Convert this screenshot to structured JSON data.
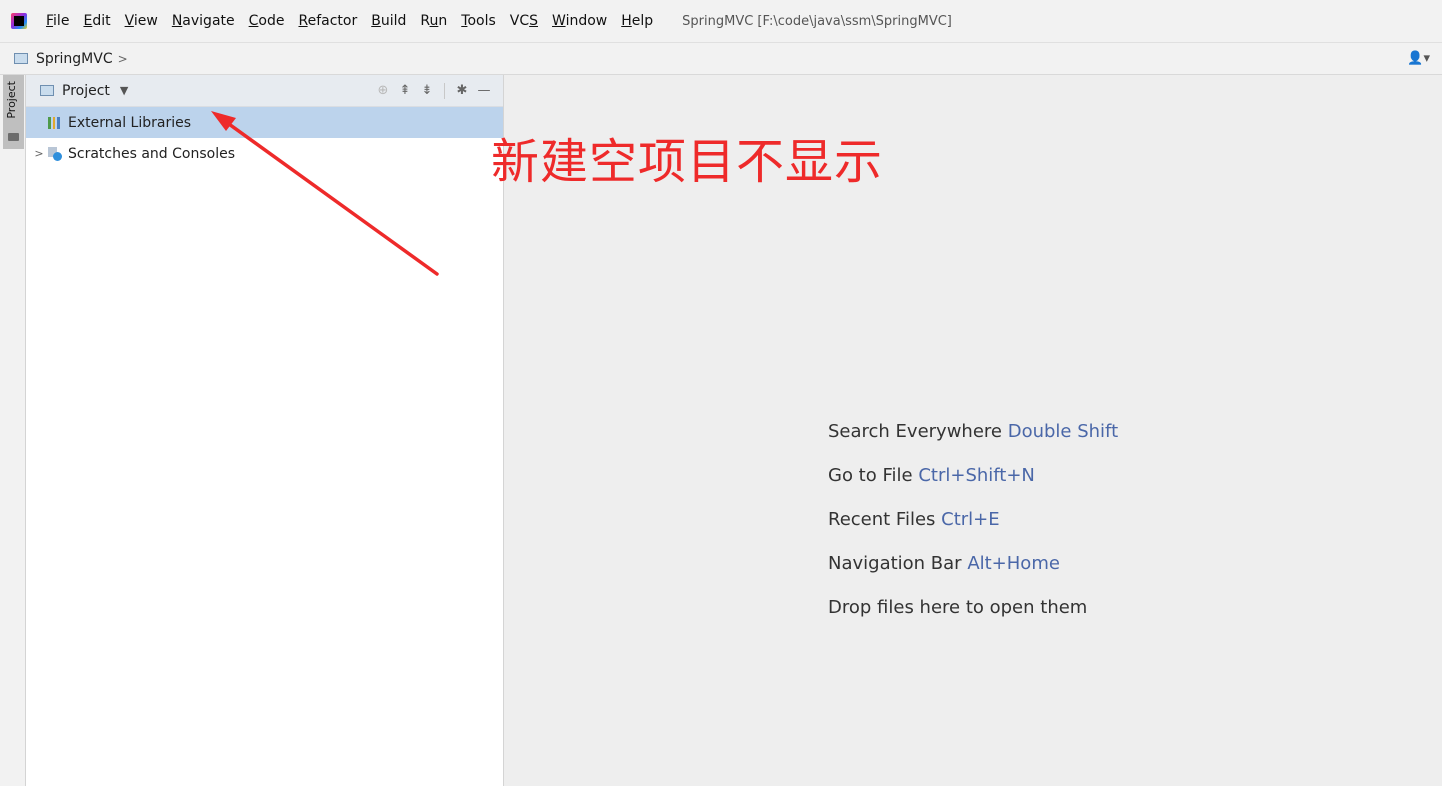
{
  "menubar": {
    "items": [
      {
        "pre": "",
        "mn": "F",
        "post": "ile"
      },
      {
        "pre": "",
        "mn": "E",
        "post": "dit"
      },
      {
        "pre": "",
        "mn": "V",
        "post": "iew"
      },
      {
        "pre": "",
        "mn": "N",
        "post": "avigate"
      },
      {
        "pre": "",
        "mn": "C",
        "post": "ode"
      },
      {
        "pre": "",
        "mn": "R",
        "post": "efactor"
      },
      {
        "pre": "",
        "mn": "B",
        "post": "uild"
      },
      {
        "pre": "R",
        "mn": "u",
        "post": "n"
      },
      {
        "pre": "",
        "mn": "T",
        "post": "ools"
      },
      {
        "pre": "VC",
        "mn": "S",
        "post": ""
      },
      {
        "pre": "",
        "mn": "W",
        "post": "indow"
      },
      {
        "pre": "",
        "mn": "H",
        "post": "elp"
      }
    ],
    "window_title": "SpringMVC [F:\\code\\java\\ssm\\SpringMVC]"
  },
  "navbar": {
    "crumb": "SpringMVC",
    "separator": ">",
    "user_icon": "👤▾"
  },
  "toolstrip": {
    "project_tab": "Project"
  },
  "project_panel": {
    "title": "Project",
    "caret": "▼",
    "tools": {
      "locate": "⊕",
      "expand_all": "⇞",
      "collapse_all": "⇟",
      "settings": "✱",
      "hide": "—"
    },
    "tree": [
      {
        "label": "External Libraries",
        "selected": true,
        "arrow": ""
      },
      {
        "label": "Scratches and Consoles",
        "selected": false,
        "arrow": ">"
      }
    ]
  },
  "editor": {
    "hints": [
      {
        "text": "Search Everywhere ",
        "key": "Double Shift"
      },
      {
        "text": "Go to File ",
        "key": "Ctrl+Shift+N"
      },
      {
        "text": "Recent Files ",
        "key": "Ctrl+E"
      },
      {
        "text": "Navigation Bar ",
        "key": "Alt+Home"
      },
      {
        "text": "Drop files here to open them",
        "key": ""
      }
    ]
  },
  "annotation": {
    "text": "新建空项目不显示",
    "color": "#ee2a2a"
  },
  "colors": {
    "selection": "#bcd3ec",
    "key_hint": "#4a67a8",
    "library_bars": [
      "#4e9a4a",
      "#e0a82e",
      "#4a7fc1"
    ]
  }
}
